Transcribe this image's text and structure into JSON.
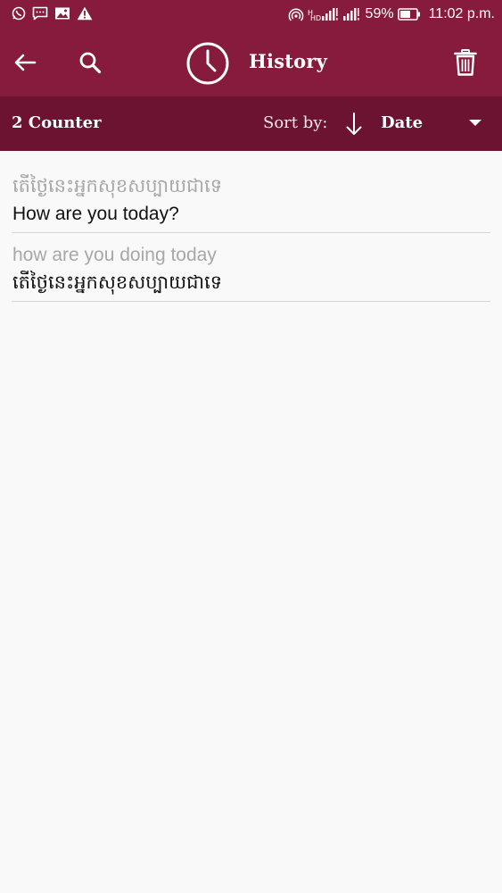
{
  "status_bar": {
    "battery": "59%",
    "time": "11:02 p.m.",
    "left_icons": [
      "whatsapp-icon",
      "message-icon",
      "gallery-icon",
      "warning-icon"
    ],
    "right_icons": [
      "hotspot-icon",
      "hd-signal-icon",
      "signal-icon"
    ]
  },
  "toolbar": {
    "title": "History",
    "back_icon": "arrow-left-icon",
    "search_icon": "search-icon",
    "title_icon": "clock-icon",
    "delete_icon": "trash-icon"
  },
  "sort_bar": {
    "counter": "2 Counter",
    "sort_label": "Sort by:",
    "sort_value": "Date",
    "direction_icon": "arrow-down-icon"
  },
  "history": [
    {
      "source": "តើថ្ងៃនេះអ្នកសុខសប្បាយជាទេ",
      "translation": "How are you today?"
    },
    {
      "source": "how are you doing today",
      "translation": "តើថ្ងៃនេះអ្នកសុខសប្បាយជាទេ"
    }
  ],
  "colors": {
    "header": "#861b3e",
    "sort_bar": "#6d1332",
    "background": "#f9f9f9",
    "source_text": "#a7a7a7",
    "translation_text": "#121212"
  }
}
